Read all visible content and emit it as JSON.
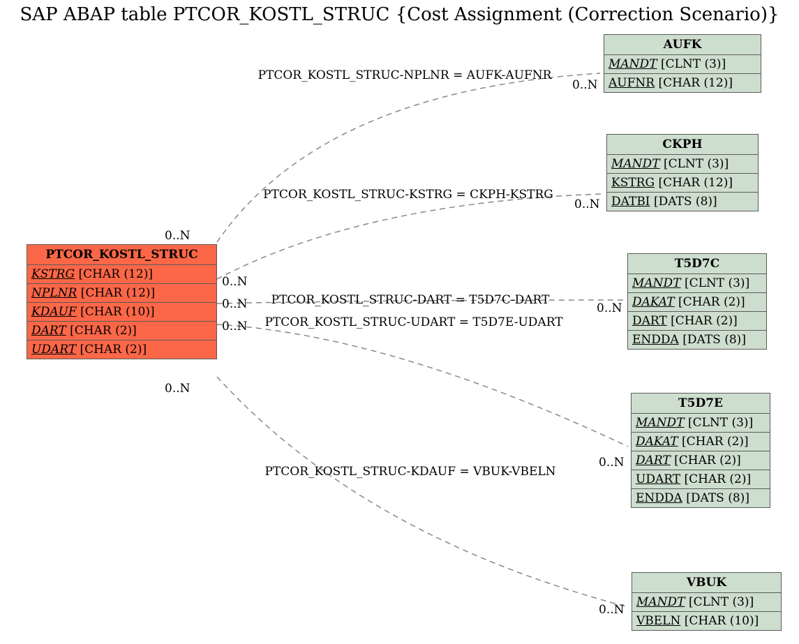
{
  "title": "SAP ABAP table PTCOR_KOSTL_STRUC {Cost Assignment (Correction Scenario)}",
  "source": {
    "name": "PTCOR_KOSTL_STRUC",
    "fields": [
      {
        "key": "KSTRG",
        "type": "[CHAR (12)]"
      },
      {
        "key": "NPLNR",
        "type": "[CHAR (12)]"
      },
      {
        "key": "KDAUF",
        "type": "[CHAR (10)]"
      },
      {
        "key": "DART",
        "type": "[CHAR (2)]"
      },
      {
        "key": "UDART",
        "type": "[CHAR (2)]"
      }
    ]
  },
  "targets": {
    "aufk": {
      "name": "AUFK",
      "fields": [
        {
          "key": "MANDT",
          "type": "[CLNT (3)]"
        },
        {
          "name": "AUFNR",
          "type": "[CHAR (12)]"
        }
      ]
    },
    "ckph": {
      "name": "CKPH",
      "fields": [
        {
          "key": "MANDT",
          "type": "[CLNT (3)]"
        },
        {
          "name": "KSTRG",
          "type": "[CHAR (12)]"
        },
        {
          "name": "DATBI",
          "type": "[DATS (8)]"
        }
      ]
    },
    "t5d7c": {
      "name": "T5D7C",
      "fields": [
        {
          "key": "MANDT",
          "type": "[CLNT (3)]"
        },
        {
          "key": "DAKAT",
          "type": "[CHAR (2)]"
        },
        {
          "name": "DART",
          "type": "[CHAR (2)]"
        },
        {
          "name": "ENDDA",
          "type": "[DATS (8)]"
        }
      ]
    },
    "t5d7e": {
      "name": "T5D7E",
      "fields": [
        {
          "key": "MANDT",
          "type": "[CLNT (3)]"
        },
        {
          "key": "DAKAT",
          "type": "[CHAR (2)]"
        },
        {
          "key": "DART",
          "type": "[CHAR (2)]"
        },
        {
          "name": "UDART",
          "type": "[CHAR (2)]"
        },
        {
          "name": "ENDDA",
          "type": "[DATS (8)]"
        }
      ]
    },
    "vbuk": {
      "name": "VBUK",
      "fields": [
        {
          "key": "MANDT",
          "type": "[CLNT (3)]"
        },
        {
          "name": "VBELN",
          "type": "[CHAR (10)]"
        }
      ]
    }
  },
  "relations": {
    "r1": {
      "label": "PTCOR_KOSTL_STRUC-NPLNR = AUFK-AUFNR",
      "cardLeft": "0..N",
      "cardRight": "0..N"
    },
    "r2": {
      "label": "PTCOR_KOSTL_STRUC-KSTRG = CKPH-KSTRG",
      "cardLeft": "0..N",
      "cardRight": "0..N"
    },
    "r3": {
      "label": "PTCOR_KOSTL_STRUC-DART = T5D7C-DART",
      "cardLeft": "0..N",
      "cardRight": "0..N"
    },
    "r4": {
      "label": "PTCOR_KOSTL_STRUC-UDART = T5D7E-UDART",
      "cardLeft": "0..N",
      "cardRight": "0..N"
    },
    "r5": {
      "label": "PTCOR_KOSTL_STRUC-KDAUF = VBUK-VBELN",
      "cardLeft": "0..N",
      "cardRight": "0..N"
    }
  }
}
